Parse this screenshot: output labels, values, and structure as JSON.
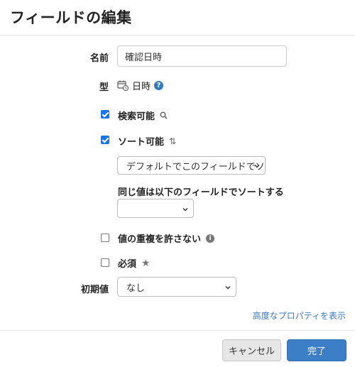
{
  "dialog": {
    "title": "フィールドの編集"
  },
  "form": {
    "name_label": "名前",
    "name_value": "確認日時",
    "type_label": "型",
    "type_icon": "datetime-icon",
    "type_value": "日時",
    "help_icon": "question-circle-icon",
    "help_glyph": "?",
    "searchable": {
      "label": "検索可能",
      "checked": true,
      "icon": "search-icon"
    },
    "sortable": {
      "label": "ソート可能",
      "checked": true,
      "icon": "sort-arrows-icon",
      "icon_glyph": "⇅"
    },
    "sort_select": {
      "value": "デフォルトでこのフィールドでソ"
    },
    "secondary_sort_label": "同じ値は以下のフィールドでソートする",
    "secondary_sort_select": {
      "value": ""
    },
    "unique": {
      "label": "値の重複を許さない",
      "checked": false,
      "icon": "info-circle-icon",
      "icon_glyph": "i"
    },
    "required": {
      "label": "必須",
      "checked": false,
      "icon": "star-icon",
      "icon_glyph": "★"
    },
    "initial_label": "初期値",
    "initial_select": {
      "value": "なし"
    }
  },
  "advanced_link": "高度なプロパティを表示",
  "footer": {
    "cancel_label": "キャンセル",
    "done_label": "完了"
  },
  "colors": {
    "primary": "#3d7fc6",
    "checkbox": "#1a73e8",
    "link": "#3a7abf"
  }
}
